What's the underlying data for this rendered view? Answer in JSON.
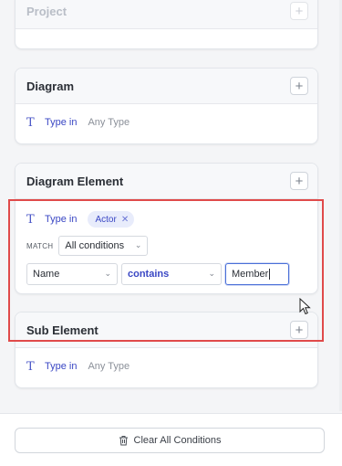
{
  "cards": [
    {
      "title": "Project"
    },
    {
      "title": "Diagram",
      "type_label": "Type in",
      "type_placeholder": "Any Type"
    },
    {
      "title": "Diagram Element",
      "type_label": "Type in",
      "chip": "Actor",
      "match_label": "MATCH",
      "match_value": "All conditions",
      "condition": {
        "field": "Name",
        "operator": "contains",
        "value": "Member"
      }
    },
    {
      "title": "Sub Element",
      "type_label": "Type in",
      "type_placeholder": "Any Type"
    }
  ],
  "footer": {
    "clear_label": "Clear All Conditions"
  },
  "colors": {
    "accent": "#3a47c4",
    "highlight": "#e04a4a",
    "chip_bg": "#e8ecfb"
  },
  "icons": {
    "type": "text-type-icon",
    "add": "plus-icon",
    "trash": "trash-icon",
    "chevron": "chevron-down-icon",
    "remove": "close-icon"
  }
}
